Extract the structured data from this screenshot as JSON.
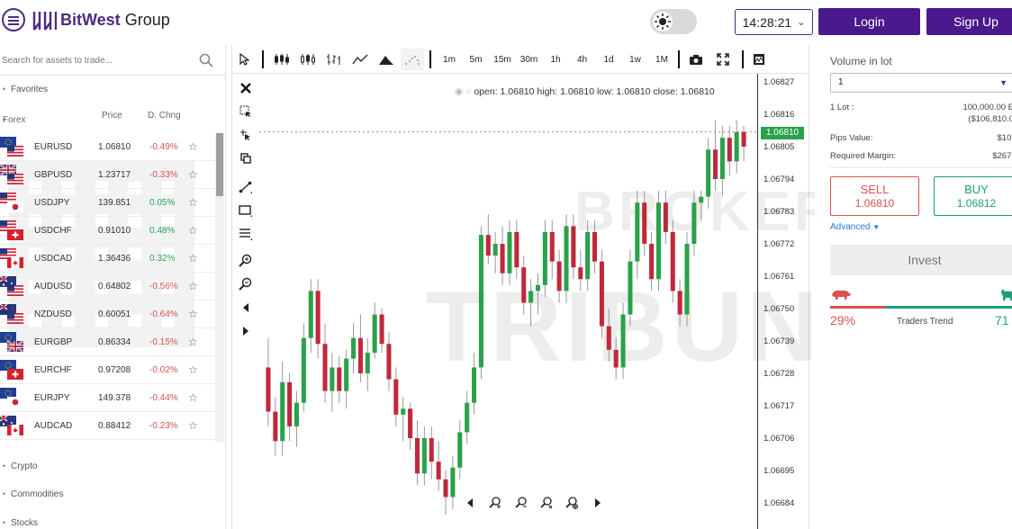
{
  "header": {
    "brand_name": "BitWest",
    "brand_suffix": "Group",
    "time": "14:28:21",
    "login_label": "Login",
    "signup_label": "Sign Up"
  },
  "search": {
    "placeholder": "Search for assets to trade..."
  },
  "groups": {
    "favorites": "Favorites",
    "forex": "Forex",
    "crypto": "Crypto",
    "commodities": "Commodities",
    "stocks": "Stocks"
  },
  "columns": {
    "price": "Price",
    "change": "D. Chng"
  },
  "assets": [
    {
      "symbol": "EURUSD",
      "price": "1.06810",
      "change": "-0.49%",
      "dir": "neg",
      "flags": [
        "eu",
        "us"
      ]
    },
    {
      "symbol": "GBPUSD",
      "price": "1.23717",
      "change": "-0.33%",
      "dir": "neg",
      "flags": [
        "gb",
        "us"
      ]
    },
    {
      "symbol": "USDJPY",
      "price": "139.851",
      "change": "0.05%",
      "dir": "pos",
      "flags": [
        "us",
        "jp"
      ]
    },
    {
      "symbol": "USDCHF",
      "price": "0.91010",
      "change": "0.48%",
      "dir": "pos",
      "flags": [
        "us",
        "ch"
      ]
    },
    {
      "symbol": "USDCAD",
      "price": "1.36436",
      "change": "0.32%",
      "dir": "pos",
      "flags": [
        "us",
        "ca"
      ]
    },
    {
      "symbol": "AUDUSD",
      "price": "0.64802",
      "change": "-0.56%",
      "dir": "neg",
      "flags": [
        "au",
        "us"
      ]
    },
    {
      "symbol": "NZDUSD",
      "price": "0.60051",
      "change": "-0.64%",
      "dir": "neg",
      "flags": [
        "nz",
        "us"
      ]
    },
    {
      "symbol": "EURGBP",
      "price": "0.86334",
      "change": "-0.15%",
      "dir": "neg",
      "flags": [
        "eu",
        "gb"
      ]
    },
    {
      "symbol": "EURCHF",
      "price": "0.97208",
      "change": "-0.02%",
      "dir": "neg",
      "flags": [
        "eu",
        "ch"
      ]
    },
    {
      "symbol": "EURJPY",
      "price": "149.378",
      "change": "-0.44%",
      "dir": "neg",
      "flags": [
        "eu",
        "jp"
      ]
    },
    {
      "symbol": "AUDCAD",
      "price": "0.88412",
      "change": "-0.23%",
      "dir": "neg",
      "flags": [
        "au",
        "ca"
      ]
    }
  ],
  "timeframes": [
    "1m",
    "5m",
    "15m",
    "30m",
    "1h",
    "4h",
    "1d",
    "1w",
    "1M"
  ],
  "ohlc": {
    "text": "open: 1.06810 high: 1.06810 low: 1.06810 close: 1.06810"
  },
  "price_axis": [
    "1.06827",
    "1.06816",
    "1.06805",
    "1.06794",
    "1.06783",
    "1.06772",
    "1.06761",
    "1.06750",
    "1.06739",
    "1.06728",
    "1.06717",
    "1.06706",
    "1.06695",
    "1.06684"
  ],
  "last_price": "1.06810",
  "colors": {
    "brand": "#4a1a8c",
    "up": "#2aa14b",
    "down": "#c0283c",
    "sell": "#d9534f",
    "buy": "#1f9d7a"
  },
  "chart_data": {
    "type": "candlestick",
    "ylim": [
      1.0668,
      1.0683
    ],
    "last": 1.0681,
    "candles": [
      [
        1.0673,
        1.0674,
        1.0671,
        1.06715
      ],
      [
        1.06715,
        1.0672,
        1.067,
        1.06705
      ],
      [
        1.06705,
        1.06732,
        1.067,
        1.06725
      ],
      [
        1.06725,
        1.06728,
        1.06705,
        1.0671
      ],
      [
        1.0671,
        1.06722,
        1.06703,
        1.06718
      ],
      [
        1.06718,
        1.06745,
        1.06715,
        1.0674
      ],
      [
        1.0674,
        1.0676,
        1.06735,
        1.06756
      ],
      [
        1.06756,
        1.0676,
        1.06733,
        1.06738
      ],
      [
        1.06738,
        1.06745,
        1.06718,
        1.06722
      ],
      [
        1.06722,
        1.06735,
        1.06715,
        1.0673
      ],
      [
        1.0673,
        1.06734,
        1.06718,
        1.06722
      ],
      [
        1.06722,
        1.06736,
        1.06716,
        1.06733
      ],
      [
        1.06733,
        1.06745,
        1.06728,
        1.0674
      ],
      [
        1.0674,
        1.06748,
        1.06725,
        1.06728
      ],
      [
        1.06728,
        1.0674,
        1.06722,
        1.06735
      ],
      [
        1.06735,
        1.06752,
        1.06733,
        1.06748
      ],
      [
        1.06748,
        1.0675,
        1.06735,
        1.06738
      ],
      [
        1.06738,
        1.06742,
        1.06722,
        1.06726
      ],
      [
        1.06726,
        1.0673,
        1.0671,
        1.06714
      ],
      [
        1.06714,
        1.0672,
        1.06705,
        1.06716
      ],
      [
        1.06716,
        1.06718,
        1.06702,
        1.06706
      ],
      [
        1.06706,
        1.06712,
        1.0669,
        1.06694
      ],
      [
        1.06694,
        1.0671,
        1.0669,
        1.06706
      ],
      [
        1.06706,
        1.0671,
        1.06692,
        1.06698
      ],
      [
        1.06698,
        1.06705,
        1.06688,
        1.06692
      ],
      [
        1.06692,
        1.06695,
        1.0668,
        1.06686
      ],
      [
        1.06686,
        1.067,
        1.06682,
        1.06696
      ],
      [
        1.06696,
        1.06712,
        1.06692,
        1.06708
      ],
      [
        1.06708,
        1.06722,
        1.06704,
        1.06718
      ],
      [
        1.06718,
        1.06735,
        1.06714,
        1.0673
      ],
      [
        1.0673,
        1.06778,
        1.06726,
        1.06775
      ],
      [
        1.06775,
        1.06782,
        1.06765,
        1.06768
      ],
      [
        1.06768,
        1.06776,
        1.06762,
        1.06772
      ],
      [
        1.06772,
        1.06778,
        1.06758,
        1.06762
      ],
      [
        1.06762,
        1.0678,
        1.06758,
        1.06776
      ],
      [
        1.06776,
        1.0678,
        1.0676,
        1.06764
      ],
      [
        1.06764,
        1.06768,
        1.06748,
        1.06752
      ],
      [
        1.06752,
        1.0676,
        1.06744,
        1.06756
      ],
      [
        1.06756,
        1.06762,
        1.06748,
        1.06758
      ],
      [
        1.06758,
        1.0678,
        1.06754,
        1.06776
      ],
      [
        1.06776,
        1.0678,
        1.0676,
        1.06766
      ],
      [
        1.06766,
        1.0677,
        1.06752,
        1.06756
      ],
      [
        1.06756,
        1.06782,
        1.06752,
        1.06778
      ],
      [
        1.06778,
        1.06782,
        1.0676,
        1.06764
      ],
      [
        1.06764,
        1.0677,
        1.06756,
        1.0676
      ],
      [
        1.0676,
        1.0678,
        1.06756,
        1.06776
      ],
      [
        1.06776,
        1.0678,
        1.06762,
        1.06766
      ],
      [
        1.06766,
        1.0677,
        1.0674,
        1.06744
      ],
      [
        1.06744,
        1.0675,
        1.06732,
        1.06736
      ],
      [
        1.06736,
        1.0674,
        1.06726,
        1.0673
      ],
      [
        1.0673,
        1.06752,
        1.06726,
        1.06748
      ],
      [
        1.06748,
        1.0677,
        1.06744,
        1.06766
      ],
      [
        1.06766,
        1.0679,
        1.0676,
        1.06786
      ],
      [
        1.06786,
        1.0679,
        1.06768,
        1.06772
      ],
      [
        1.06772,
        1.06776,
        1.06756,
        1.0676
      ],
      [
        1.0676,
        1.0679,
        1.06756,
        1.06786
      ],
      [
        1.06786,
        1.0679,
        1.06772,
        1.06776
      ],
      [
        1.06776,
        1.0678,
        1.06752,
        1.06756
      ],
      [
        1.06756,
        1.0676,
        1.06744,
        1.06748
      ],
      [
        1.06748,
        1.06776,
        1.06744,
        1.06772
      ],
      [
        1.06772,
        1.0679,
        1.06768,
        1.06786
      ],
      [
        1.06786,
        1.0679,
        1.0678,
        1.06788
      ],
      [
        1.06788,
        1.06808,
        1.06784,
        1.06804
      ],
      [
        1.06804,
        1.06814,
        1.0679,
        1.06794
      ],
      [
        1.06794,
        1.06812,
        1.06788,
        1.06808
      ],
      [
        1.06808,
        1.06812,
        1.06795,
        1.068
      ],
      [
        1.068,
        1.06814,
        1.06796,
        1.0681
      ],
      [
        1.0681,
        1.06812,
        1.068,
        1.06805
      ]
    ]
  },
  "order_panel": {
    "volume_label": "Volume in lot",
    "volume_value": "1",
    "lot_label": "1 Lot :",
    "lot_value": "100,000.00 E",
    "lot_value2": "($106,810.0",
    "pips_label": "Pips Value:",
    "pips_value": "$10.",
    "margin_label": "Required Margin:",
    "margin_value": "$267.",
    "sell_label": "SELL",
    "sell_price": "1.06810",
    "buy_label": "BUY",
    "buy_price": "1.06812",
    "advanced_label": "Advanced",
    "invest_label": "Invest",
    "bear_pct": "29%",
    "trend_label": "Traders Trend",
    "bull_pct": "71"
  },
  "watermark": {
    "line1": "BROKER",
    "line2": "TRIBUNAL"
  }
}
